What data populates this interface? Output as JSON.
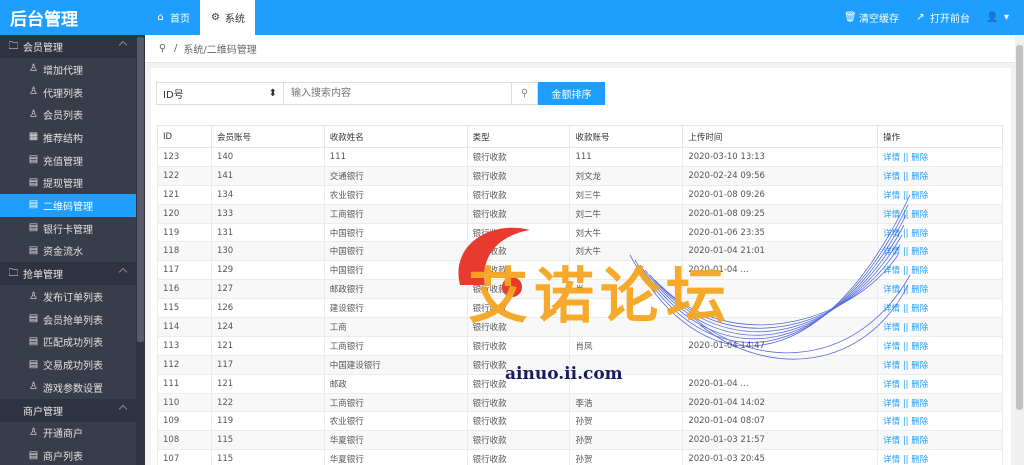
{
  "header": {
    "logo": "后台管理",
    "tabs": [
      {
        "label": "首页",
        "icon": "home-icon",
        "active": false
      },
      {
        "label": "系统",
        "icon": "gear-icon",
        "active": true
      }
    ],
    "right": {
      "clear_cache": "清空缓存",
      "open_front": "打开前台"
    }
  },
  "sidebar": {
    "groups": [
      {
        "title": "会员管理",
        "items": [
          "增加代理",
          "代理列表",
          "会员列表",
          "推荐结构",
          "充值管理",
          "提现管理",
          "二维码管理",
          "银行卡管理",
          "资金流水"
        ]
      },
      {
        "title": "抢单管理",
        "items": [
          "发布订单列表",
          "会员抢单列表",
          "匹配成功列表",
          "交易成功列表",
          "游戏参数设置"
        ]
      },
      {
        "title": "商户管理",
        "items": [
          "开通商户",
          "商户列表"
        ]
      }
    ],
    "active_item": "二维码管理"
  },
  "breadcrumb": {
    "path": "系统/二维码管理"
  },
  "filters": {
    "select_value": "ID号",
    "search_placeholder": "输入搜索内容",
    "sort_label": "金额排序"
  },
  "table": {
    "columns": [
      "ID",
      "会员账号",
      "收款姓名",
      "类型",
      "收款账号",
      "上传时间",
      "操作"
    ],
    "detail_label": "详情",
    "sep": "||",
    "delete_label": "删除",
    "rows": [
      [
        "123",
        "140",
        "111",
        "银行收款",
        "111",
        "2020-03-10 13:13"
      ],
      [
        "122",
        "141",
        "交通银行",
        "银行收款",
        "刘文龙",
        "2020-02-24 09:56"
      ],
      [
        "121",
        "134",
        "农业银行",
        "银行收款",
        "刘三牛",
        "2020-01-08 09:26"
      ],
      [
        "120",
        "133",
        "工商银行",
        "银行收款",
        "刘二牛",
        "2020-01-08 09:25"
      ],
      [
        "119",
        "131",
        "中国银行",
        "银行收款",
        "刘大牛",
        "2020-01-06 23:35"
      ],
      [
        "118",
        "130",
        "中国银行",
        "银行收款",
        "刘大牛",
        "2020-01-04 21:01"
      ],
      [
        "117",
        "129",
        "中国银行",
        "银行收款",
        "",
        "2020-01-04 ..."
      ],
      [
        "116",
        "127",
        "邮政银行",
        "银行收款",
        "肖",
        ""
      ],
      [
        "115",
        "126",
        "建设银行",
        "银行收款",
        "",
        ""
      ],
      [
        "114",
        "124",
        "工商",
        "银行收款",
        "",
        ""
      ],
      [
        "113",
        "121",
        "工商银行",
        "银行收款",
        "肖凤",
        "2020-01-04 14:47"
      ],
      [
        "112",
        "117",
        "中国建设银行",
        "银行收款",
        "",
        ""
      ],
      [
        "111",
        "121",
        "邮政",
        "银行收款",
        "",
        "2020-01-04 ..."
      ],
      [
        "110",
        "122",
        "工商银行",
        "银行收款",
        "李浩",
        "2020-01-04 14:02"
      ],
      [
        "109",
        "119",
        "农业银行",
        "银行收款",
        "孙贺",
        "2020-01-04 08:07"
      ],
      [
        "108",
        "115",
        "华夏银行",
        "银行收款",
        "孙贺",
        "2020-01-03 21:57"
      ],
      [
        "107",
        "115",
        "华夏银行",
        "银行收款",
        "孙贺",
        "2020-01-03 20:45"
      ]
    ]
  },
  "watermark": {
    "text": "艾诺论坛",
    "url": "ainuo.ii.com"
  }
}
